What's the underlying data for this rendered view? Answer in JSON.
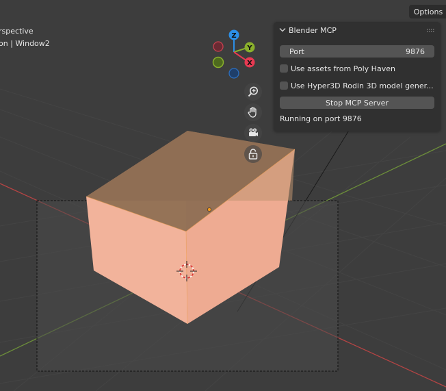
{
  "viewport": {
    "view_name": "rspective",
    "collection_label": "on | Window2",
    "options_label": "Options"
  },
  "gizmo": {
    "x_label": "X",
    "y_label": "Y",
    "z_label": "Z",
    "colors": {
      "x": "#e83a52",
      "y": "#8ab02c",
      "z": "#2c8fe6"
    }
  },
  "nav_icons": [
    "zoom-icon",
    "pan-hand-icon",
    "camera-icon",
    "lock-icon"
  ],
  "mcp_panel": {
    "title": "Blender MCP",
    "port_label": "Port",
    "port_value": "9876",
    "polyhaven_label": "Use assets from Poly Haven",
    "polyhaven_checked": false,
    "hyper3d_label": "Use Hyper3D Rodin 3D model gener...",
    "hyper3d_checked": false,
    "stop_button_label": "Stop MCP Server",
    "status": "Running on port 9876"
  },
  "colors": {
    "background": "#3d3d3d",
    "panel": "#303030",
    "field": "#545454",
    "cube_front": "#f0b29a",
    "cube_top": "#8d6e54",
    "selection_outline": "#f59a1f",
    "axis_x": "#b44444",
    "axis_y": "#6c8e3a"
  }
}
